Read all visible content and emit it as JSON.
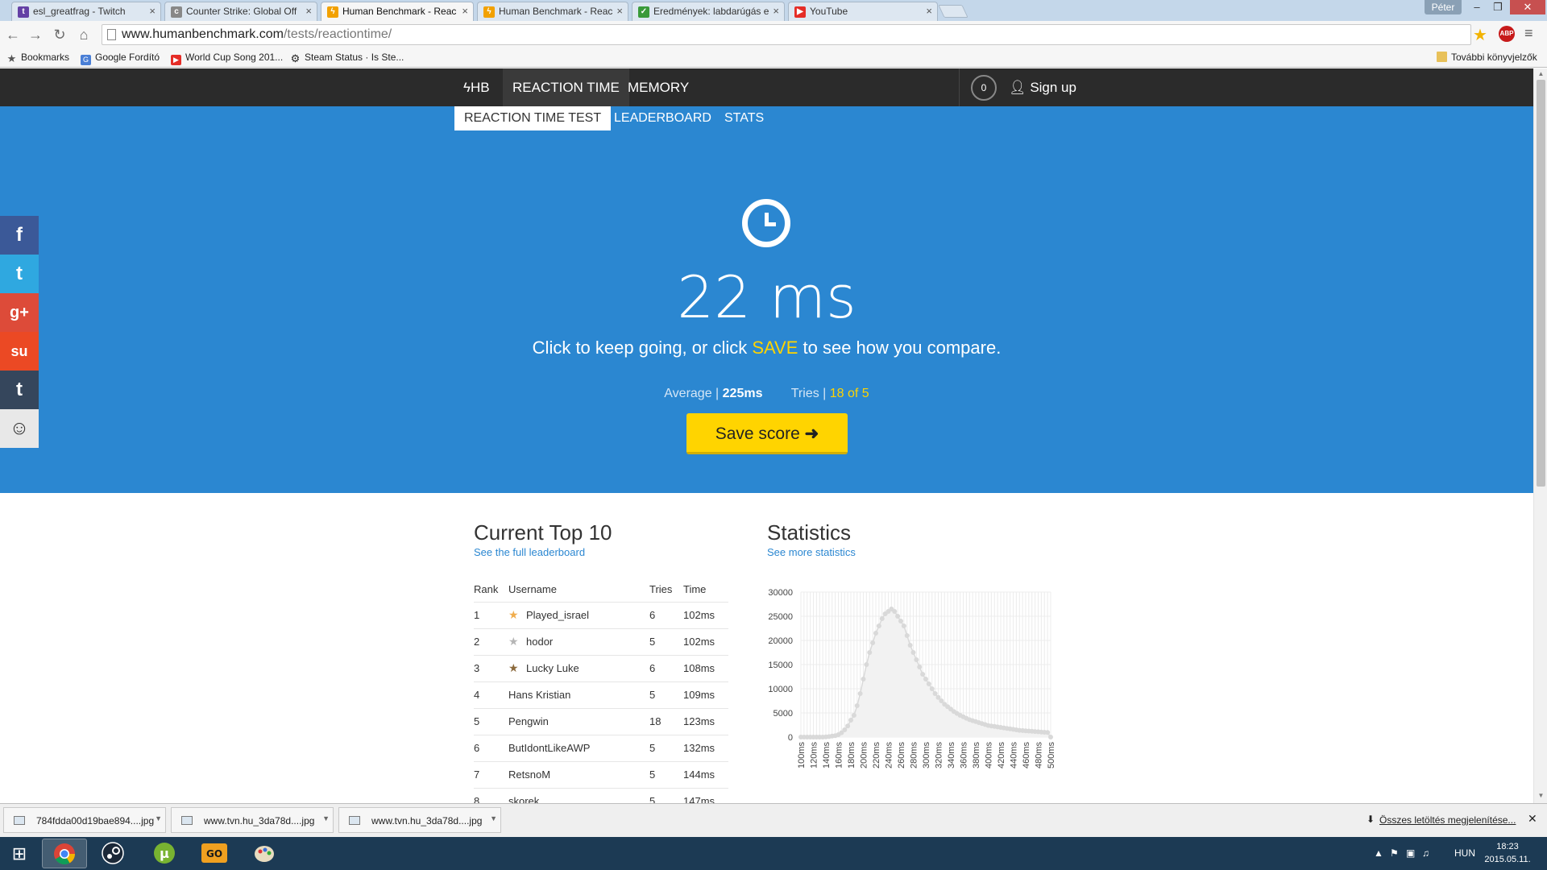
{
  "browser": {
    "tabs": [
      {
        "title": "esl_greatfrag - Twitch",
        "favicon": "twitch-icon",
        "color": "#6441a5"
      },
      {
        "title": "Counter Strike: Global Off",
        "favicon": "chat-icon",
        "color": "#888888"
      },
      {
        "title": "Human Benchmark - Reac",
        "favicon": "bolt-icon",
        "color": "#f2a100",
        "active": true
      },
      {
        "title": "Human Benchmark - Reac",
        "favicon": "bolt-icon",
        "color": "#f2a100"
      },
      {
        "title": "Eredmények: labdarúgás e",
        "favicon": "check-icon",
        "color": "#3a9a3a"
      },
      {
        "title": "YouTube",
        "favicon": "youtube-icon",
        "color": "#e52d27"
      }
    ],
    "profile": "Péter",
    "url_host": "www.humanbenchmark.com",
    "url_path": "/tests/reactiontime/",
    "bookmarks": [
      {
        "label": "Bookmarks",
        "icon": "star-icon"
      },
      {
        "label": "Google Fordító",
        "icon": "translate-icon"
      },
      {
        "label": "World Cup Song 201...",
        "icon": "youtube-icon"
      },
      {
        "label": "Steam Status · Is Ste...",
        "icon": "gear-icon"
      }
    ],
    "other_bookmarks": "További könyvjelzők"
  },
  "site": {
    "nav": {
      "logo": "HB",
      "reaction_time": "REACTION TIME",
      "memory": "MEMORY",
      "score": "0",
      "sign_up": "Sign up"
    },
    "subnav": {
      "test": "REACTION TIME TEST",
      "leaderboard": "LEADERBOARD",
      "stats": "STATS"
    },
    "hero": {
      "result": "22 ms",
      "hint_before": "Click to keep going, or click ",
      "hint_save": "SAVE",
      "hint_after": " to see how you compare.",
      "average_label": "Average |",
      "average_value": "225ms",
      "tries_label": "Tries |",
      "tries_value": "18 of 5",
      "save_button": "Save score"
    },
    "social": [
      {
        "name": "facebook",
        "glyph": "f",
        "color": "#3b5998"
      },
      {
        "name": "twitter",
        "glyph": "t",
        "color": "#2fa8e0"
      },
      {
        "name": "google-plus",
        "glyph": "g+",
        "color": "#dd4b39"
      },
      {
        "name": "stumbleupon",
        "glyph": "su",
        "color": "#eb4924"
      },
      {
        "name": "tumblr",
        "glyph": "t",
        "color": "#35465c"
      },
      {
        "name": "reddit",
        "glyph": "r",
        "color": "#e8e8e8"
      }
    ],
    "top10": {
      "title": "Current Top 10",
      "link": "See the full leaderboard",
      "headers": [
        "Rank",
        "Username",
        "Tries",
        "Time"
      ],
      "rows": [
        {
          "rank": "1",
          "user": "Played_israel",
          "tries": "6",
          "time": "102ms",
          "medal": "gold"
        },
        {
          "rank": "2",
          "user": "hodor",
          "tries": "5",
          "time": "102ms",
          "medal": "silver"
        },
        {
          "rank": "3",
          "user": "Lucky Luke",
          "tries": "6",
          "time": "108ms",
          "medal": "bronze"
        },
        {
          "rank": "4",
          "user": "Hans Kristian",
          "tries": "5",
          "time": "109ms"
        },
        {
          "rank": "5",
          "user": "Pengwin",
          "tries": "18",
          "time": "123ms"
        },
        {
          "rank": "6",
          "user": "ButIdontLikeAWP",
          "tries": "5",
          "time": "132ms"
        },
        {
          "rank": "7",
          "user": "RetsnoM",
          "tries": "5",
          "time": "144ms"
        },
        {
          "rank": "8",
          "user": "skorek",
          "tries": "5",
          "time": "147ms"
        }
      ]
    },
    "statistics": {
      "title": "Statistics",
      "link": "See more statistics"
    }
  },
  "chart_data": {
    "type": "line",
    "title": "",
    "xlabel": "",
    "ylabel": "",
    "ylim": [
      0,
      30000
    ],
    "yticks": [
      0,
      5000,
      10000,
      15000,
      20000,
      25000,
      30000
    ],
    "xticklabels": [
      "100ms",
      "120ms",
      "140ms",
      "160ms",
      "180ms",
      "200ms",
      "220ms",
      "240ms",
      "260ms",
      "280ms",
      "300ms",
      "320ms",
      "340ms",
      "360ms",
      "380ms",
      "400ms",
      "420ms",
      "440ms",
      "460ms",
      "480ms",
      "500ms"
    ],
    "x": [
      100,
      105,
      110,
      115,
      120,
      125,
      130,
      135,
      140,
      145,
      150,
      155,
      160,
      165,
      170,
      175,
      180,
      185,
      190,
      195,
      200,
      205,
      210,
      215,
      220,
      225,
      230,
      235,
      240,
      245,
      250,
      255,
      260,
      265,
      270,
      275,
      280,
      285,
      290,
      295,
      300,
      305,
      310,
      315,
      320,
      325,
      330,
      335,
      340,
      345,
      350,
      355,
      360,
      365,
      370,
      375,
      380,
      385,
      390,
      395,
      400,
      405,
      410,
      415,
      420,
      425,
      430,
      435,
      440,
      445,
      450,
      455,
      460,
      465,
      470,
      475,
      480,
      485,
      490,
      495,
      500
    ],
    "values": [
      0,
      0,
      0,
      0,
      0,
      0,
      0,
      0,
      50,
      100,
      200,
      300,
      500,
      900,
      1500,
      2300,
      3500,
      4500,
      6500,
      9000,
      12000,
      15000,
      17500,
      19500,
      21500,
      23000,
      24500,
      25500,
      26000,
      26500,
      26000,
      25000,
      24000,
      23000,
      21000,
      19000,
      17500,
      16000,
      14500,
      13000,
      12000,
      11000,
      10000,
      9000,
      8200,
      7500,
      6800,
      6300,
      5800,
      5300,
      4900,
      4500,
      4200,
      3900,
      3600,
      3400,
      3200,
      3000,
      2800,
      2600,
      2400,
      2300,
      2200,
      2100,
      2000,
      1900,
      1800,
      1700,
      1600,
      1500,
      1400,
      1350,
      1300,
      1250,
      1200,
      1150,
      1100,
      1050,
      1000,
      950,
      0
    ],
    "grid": true,
    "marker_color": "#d9d9d9"
  },
  "downloads": {
    "items": [
      "784fdda00d19bae894....jpg",
      "www.tvn.hu_3da78d....jpg",
      "www.tvn.hu_3da78d....jpg"
    ],
    "show_all": "Összes letöltés megjelenítése..."
  },
  "taskbar": {
    "lang": "HUN",
    "time": "18:23",
    "date": "2015.05.11."
  }
}
